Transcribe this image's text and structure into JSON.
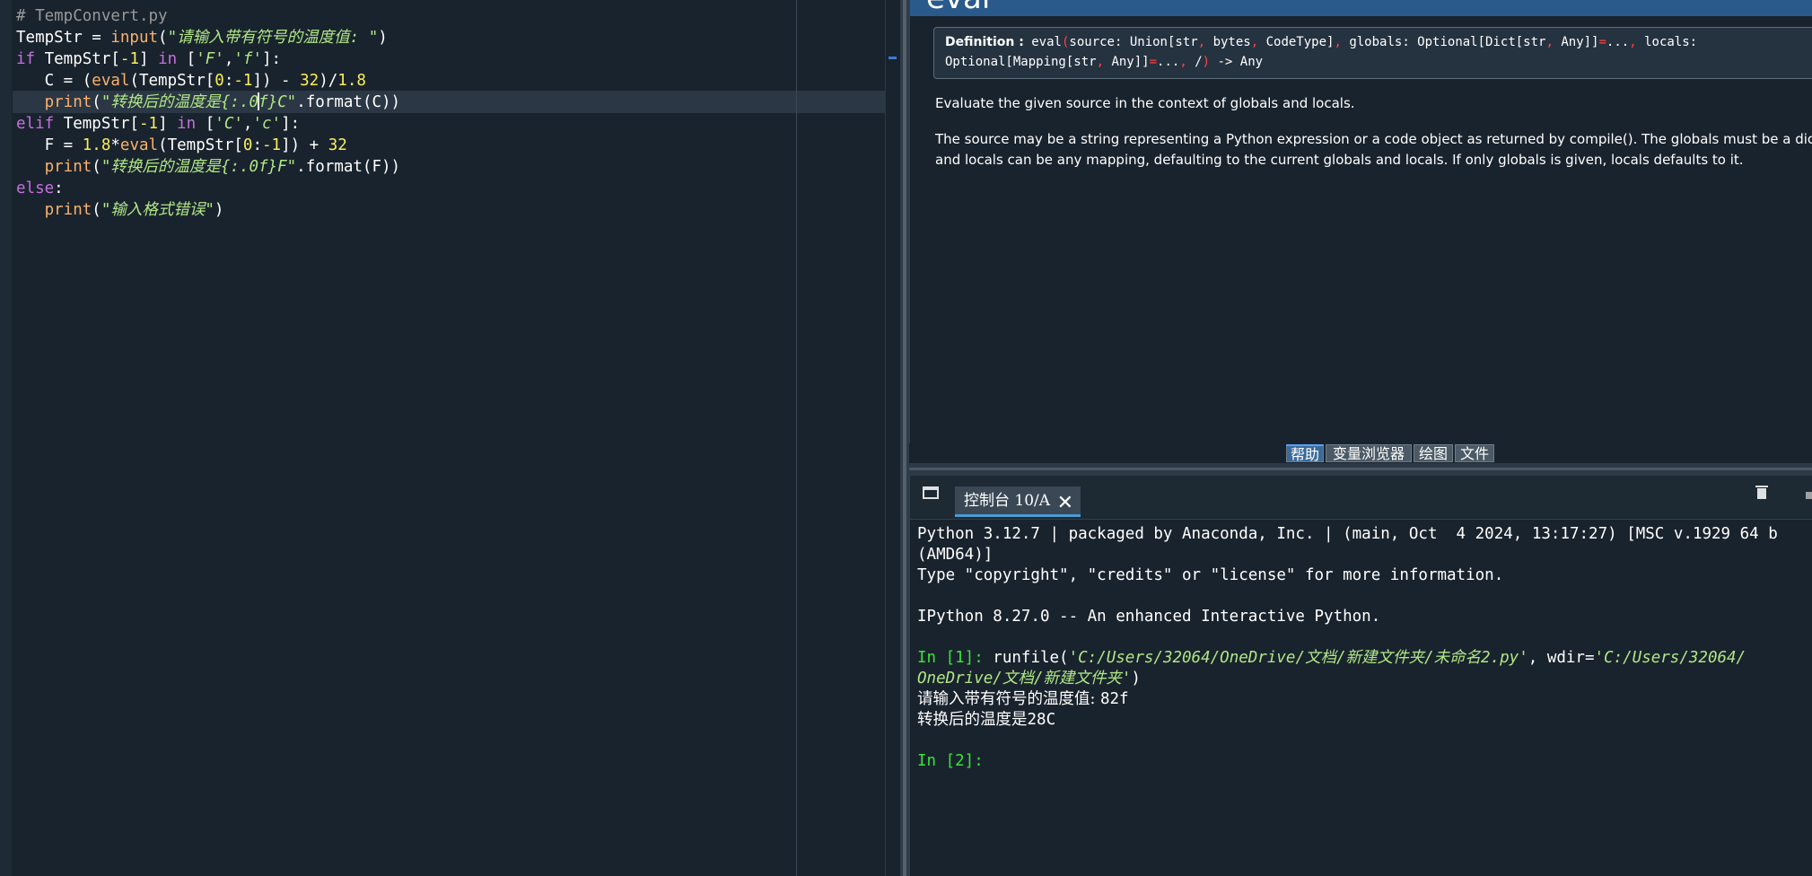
{
  "editor": {
    "lines": [
      {
        "id": "l1",
        "parts": [
          {
            "t": "# TempConvert.py",
            "c": "com"
          }
        ]
      },
      {
        "id": "l2",
        "parts": [
          {
            "t": "TempStr = ",
            "c": "op"
          },
          {
            "t": "input",
            "c": "bi"
          },
          {
            "t": "(",
            "c": "op"
          },
          {
            "t": "\"请输入带有符号的温度值: \"",
            "c": "str"
          },
          {
            "t": ")",
            "c": "op"
          }
        ]
      },
      {
        "id": "l3",
        "parts": [
          {
            "t": "if",
            "c": "kw"
          },
          {
            "t": " TempStr[",
            "c": "op"
          },
          {
            "t": "-1",
            "c": "num"
          },
          {
            "t": "] ",
            "c": "op"
          },
          {
            "t": "in",
            "c": "kw"
          },
          {
            "t": " [",
            "c": "op"
          },
          {
            "t": "'F'",
            "c": "str"
          },
          {
            "t": ",",
            "c": "op"
          },
          {
            "t": "'f'",
            "c": "str"
          },
          {
            "t": "]:",
            "c": "op"
          }
        ]
      },
      {
        "id": "l4",
        "parts": [
          {
            "t": "   C = (",
            "c": "op"
          },
          {
            "t": "eval",
            "c": "bi"
          },
          {
            "t": "(TempStr[",
            "c": "op"
          },
          {
            "t": "0",
            "c": "num"
          },
          {
            "t": ":",
            "c": "op"
          },
          {
            "t": "-1",
            "c": "num"
          },
          {
            "t": "]) - ",
            "c": "op"
          },
          {
            "t": "32",
            "c": "num"
          },
          {
            "t": ")/",
            "c": "op"
          },
          {
            "t": "1.8",
            "c": "num"
          }
        ]
      },
      {
        "id": "l5",
        "parts": [
          {
            "t": "   ",
            "c": "op"
          },
          {
            "t": "print",
            "c": "bi"
          },
          {
            "t": "(",
            "c": "op"
          },
          {
            "t": "\"转换后的温度是{:.0",
            "c": "str"
          },
          {
            "caret": true
          },
          {
            "t": "f}C\"",
            "c": "str"
          },
          {
            "t": ".format(C))",
            "c": "op"
          }
        ]
      },
      {
        "id": "l6",
        "parts": [
          {
            "t": "elif",
            "c": "kw"
          },
          {
            "t": " TempStr[",
            "c": "op"
          },
          {
            "t": "-1",
            "c": "num"
          },
          {
            "t": "] ",
            "c": "op"
          },
          {
            "t": "in",
            "c": "kw"
          },
          {
            "t": " [",
            "c": "op"
          },
          {
            "t": "'C'",
            "c": "str"
          },
          {
            "t": ",",
            "c": "op"
          },
          {
            "t": "'c'",
            "c": "str"
          },
          {
            "t": "]:",
            "c": "op"
          }
        ]
      },
      {
        "id": "l7",
        "parts": [
          {
            "t": "   F = ",
            "c": "op"
          },
          {
            "t": "1.8",
            "c": "num"
          },
          {
            "t": "*",
            "c": "op"
          },
          {
            "t": "eval",
            "c": "bi"
          },
          {
            "t": "(TempStr[",
            "c": "op"
          },
          {
            "t": "0",
            "c": "num"
          },
          {
            "t": ":",
            "c": "op"
          },
          {
            "t": "-1",
            "c": "num"
          },
          {
            "t": "]) + ",
            "c": "op"
          },
          {
            "t": "32",
            "c": "num"
          }
        ]
      },
      {
        "id": "l8",
        "parts": [
          {
            "t": "   ",
            "c": "op"
          },
          {
            "t": "print",
            "c": "bi"
          },
          {
            "t": "(",
            "c": "op"
          },
          {
            "t": "\"转换后的温度是{:.0f}F\"",
            "c": "str"
          },
          {
            "t": ".format(F))",
            "c": "op"
          }
        ]
      },
      {
        "id": "l9",
        "parts": [
          {
            "t": "else",
            "c": "kw"
          },
          {
            "t": ":",
            "c": "op"
          }
        ]
      },
      {
        "id": "l10",
        "parts": [
          {
            "t": "   ",
            "c": "op"
          },
          {
            "t": "print",
            "c": "bi"
          },
          {
            "t": "(",
            "c": "op"
          },
          {
            "t": "\"输入格式错误\"",
            "c": "str"
          },
          {
            "t": ")",
            "c": "op"
          }
        ]
      }
    ]
  },
  "help": {
    "title": "eval",
    "definition_label": "Definition :",
    "def_line1": [
      {
        "t": "eval",
        "c": ""
      },
      {
        "t": "(",
        "c": "red"
      },
      {
        "t": "source: Union[str",
        "c": ""
      },
      {
        "t": ",",
        "c": "red"
      },
      {
        "t": " bytes",
        "c": ""
      },
      {
        "t": ",",
        "c": "red"
      },
      {
        "t": " CodeType]",
        "c": ""
      },
      {
        "t": ",",
        "c": "red"
      },
      {
        "t": " globals: Optional[Dict[str",
        "c": ""
      },
      {
        "t": ",",
        "c": "red"
      },
      {
        "t": " Any]]",
        "c": ""
      },
      {
        "t": "=",
        "c": "red"
      },
      {
        "t": "...",
        "c": ""
      },
      {
        "t": ",",
        "c": "red"
      },
      {
        "t": " locals:",
        "c": ""
      }
    ],
    "def_line2": [
      {
        "t": "Optional[Mapping[str",
        "c": ""
      },
      {
        "t": ",",
        "c": "red"
      },
      {
        "t": " Any]]",
        "c": ""
      },
      {
        "t": "=",
        "c": "red"
      },
      {
        "t": "...",
        "c": ""
      },
      {
        "t": ",",
        "c": "red"
      },
      {
        "t": " /",
        "c": ""
      },
      {
        "t": ")",
        "c": "red"
      },
      {
        "t": " -> Any",
        "c": ""
      }
    ],
    "summary": "Evaluate the given source in the context of globals and locals.",
    "body_line1": "The source may be a string representing a Python expression or a code object as returned by compile(). The globals must be a dictiona",
    "body_line2": "and locals can be any mapping, defaulting to the current globals and locals. If only globals is given, locals defaults to it."
  },
  "pane_tabs": [
    "帮助",
    "变量浏览器",
    "绘图",
    "文件"
  ],
  "console": {
    "tab_label": "控制台 10/A",
    "lines": [
      {
        "parts": [
          {
            "t": "Python 3.12.7 | packaged by Anaconda, Inc. | (main, Oct  4 2024, 13:17:27) [MSC v.1929 64 b",
            "c": ""
          }
        ]
      },
      {
        "parts": [
          {
            "t": "(AMD64)]",
            "c": ""
          }
        ]
      },
      {
        "parts": [
          {
            "t": "Type \"copyright\", \"credits\" or \"license\" for more information.",
            "c": ""
          }
        ]
      },
      {
        "parts": []
      },
      {
        "parts": [
          {
            "t": "IPython 8.27.0 -- An enhanced Interactive Python.",
            "c": ""
          }
        ]
      },
      {
        "parts": []
      },
      {
        "parts": [
          {
            "t": "In [1]: ",
            "c": "prompt"
          },
          {
            "t": "runfile(",
            "c": ""
          },
          {
            "t": "'C:/Users/32064/OneDrive/文档/新建文件夹/未命名2.py'",
            "c": "path"
          },
          {
            "t": ", wdir=",
            "c": ""
          },
          {
            "t": "'C:/Users/32064/",
            "c": "path"
          }
        ]
      },
      {
        "parts": [
          {
            "t": "OneDrive/文档/新建文件夹'",
            "c": "path"
          },
          {
            "t": ")",
            "c": ""
          }
        ]
      },
      {
        "parts": [
          {
            "t": "请输入带有符号的温度值: ",
            "c": "zh"
          },
          {
            "t": "82f",
            "c": ""
          }
        ]
      },
      {
        "parts": [
          {
            "t": "转换后的温度是",
            "c": "zh"
          },
          {
            "t": "28C",
            "c": ""
          }
        ]
      },
      {
        "parts": []
      },
      {
        "parts": [
          {
            "t": "In [2]:",
            "c": "prompt"
          }
        ]
      }
    ]
  }
}
